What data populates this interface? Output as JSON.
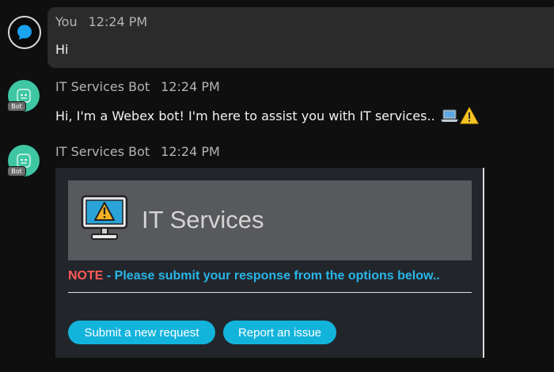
{
  "messages": {
    "self": {
      "sender": "You",
      "time": "12:24 PM",
      "text": "Hi"
    },
    "bot1": {
      "sender": "IT Services Bot",
      "time": "12:24 PM",
      "text": "Hi, I'm a Webex bot! I'm here to assist you with IT services..",
      "badge": "Bot",
      "trailing_icons": [
        "laptop-icon",
        "warning-icon"
      ]
    },
    "bot2": {
      "sender": "IT Services Bot",
      "time": "12:24 PM",
      "badge": "Bot"
    }
  },
  "card": {
    "title": "IT Services",
    "note_label": "NOTE",
    "note_dash": " - ",
    "note_text": "Please submit your response from the options below..",
    "buttons": {
      "submit": "Submit a new request",
      "report": "Report an issue"
    },
    "header_icon": "monitor-warning-icon"
  },
  "colors": {
    "background": "#0f0f0f",
    "self_bubble": "#2b2b2b",
    "bot_avatar": "#3ec7a2",
    "card_bg": "#22262b",
    "card_header_bg": "#57595c",
    "note_red": "#ff5a5a",
    "note_blue": "#29b5e8",
    "button_bg": "#13b4dc",
    "self_avatar_icon": "#1aa3f0"
  }
}
